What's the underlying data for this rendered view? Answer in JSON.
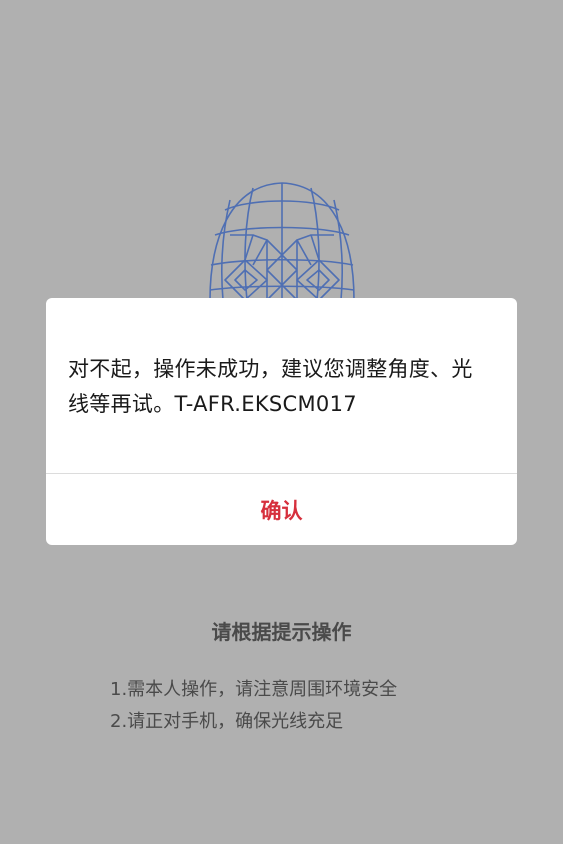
{
  "colors": {
    "background": "#b0b0b0",
    "dialog_background": "#ffffff",
    "confirm_text": "#d6303d",
    "face_mesh": "#4f6fb3"
  },
  "face_icon": "face-mesh-icon",
  "dialog": {
    "message": "对不起，操作未成功，建议您调整角度、光线等再试。T-AFR.EKSCM017",
    "confirm_label": "确认"
  },
  "instructions": {
    "title": "请根据提示操作",
    "items": [
      "1.需本人操作，请注意周围环境安全",
      "2.请正对手机，确保光线充足"
    ]
  }
}
